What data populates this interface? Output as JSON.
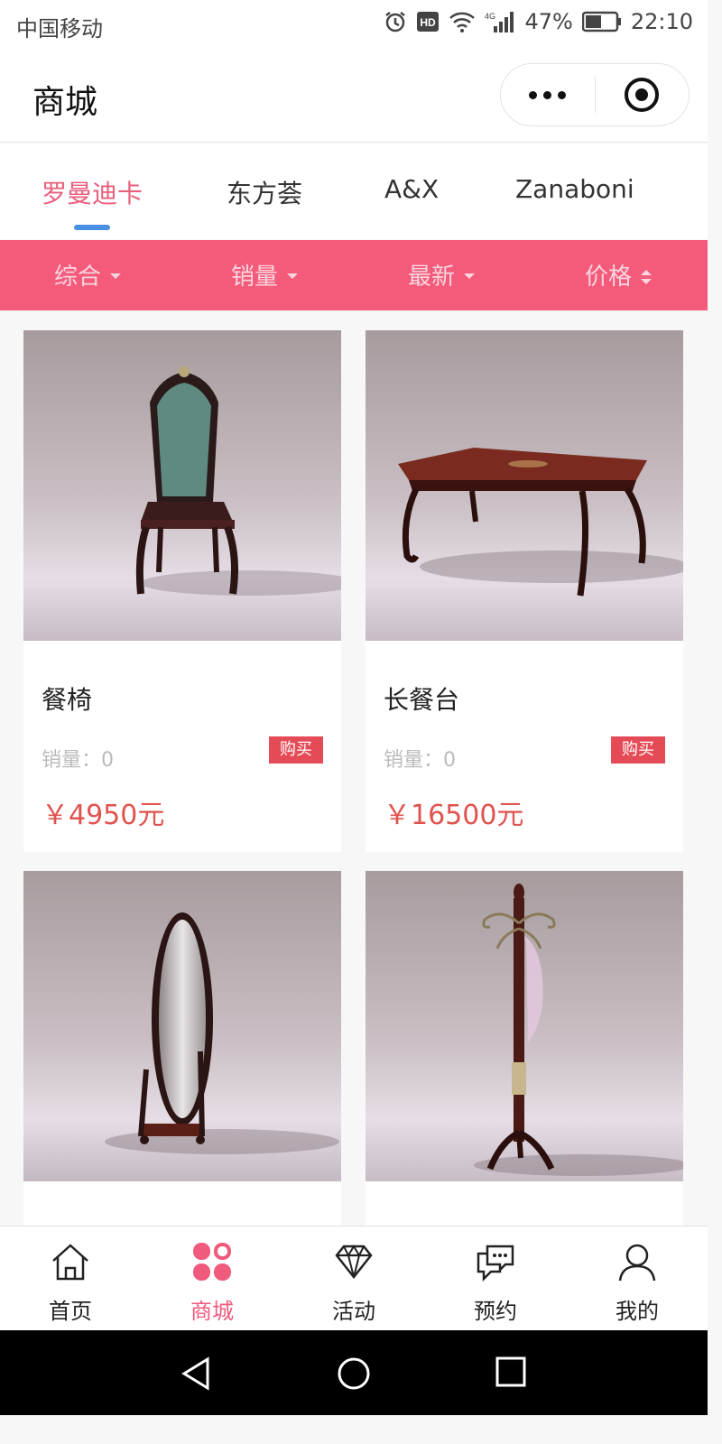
{
  "status_bar": {
    "carrier": "中国移动",
    "battery": "47%",
    "time": "22:10",
    "icons": [
      "alarm-icon",
      "hd-icon",
      "wifi-icon",
      "signal-4g-icon",
      "battery-icon"
    ]
  },
  "header": {
    "title": "商城",
    "menu_icon": "more-dots-icon",
    "close_icon": "target-close-icon"
  },
  "brand_tabs": [
    {
      "label": "罗曼迪卡",
      "active": true
    },
    {
      "label": "东方荟",
      "active": false
    },
    {
      "label": "A&X",
      "active": false
    },
    {
      "label": "Zanaboni",
      "active": false
    }
  ],
  "sort_bar": {
    "items": [
      {
        "label": "综合",
        "icon": "caret-down-icon"
      },
      {
        "label": "销量",
        "icon": "caret-down-icon"
      },
      {
        "label": "最新",
        "icon": "caret-down-icon"
      },
      {
        "label": "价格",
        "icon": "sort-updown-icon"
      }
    ]
  },
  "products": [
    {
      "name": "餐椅",
      "sales": "销量：0",
      "buy_label": "购买",
      "price": "￥4950元",
      "image": "dining-chair"
    },
    {
      "name": "长餐台",
      "sales": "销量：0",
      "buy_label": "购买",
      "price": "￥16500元",
      "image": "dining-table"
    },
    {
      "name": "",
      "sales": "",
      "buy_label": "",
      "price": "",
      "image": "floor-mirror"
    },
    {
      "name": "",
      "sales": "",
      "buy_label": "",
      "price": "",
      "image": "coat-rack"
    }
  ],
  "tab_bar": [
    {
      "label": "首页",
      "icon": "home-icon",
      "active": false
    },
    {
      "label": "商城",
      "icon": "mall-grid-icon",
      "active": true
    },
    {
      "label": "活动",
      "icon": "diamond-icon",
      "active": false
    },
    {
      "label": "预约",
      "icon": "chat-icon",
      "active": false
    },
    {
      "label": "我的",
      "icon": "user-icon",
      "active": false
    }
  ],
  "colors": {
    "accent_pink": "#f45a7a",
    "tab_active": "#e85e7c",
    "price_red": "#e0534f",
    "buy_red": "#e54b57",
    "underline_blue": "#4a90e2"
  }
}
